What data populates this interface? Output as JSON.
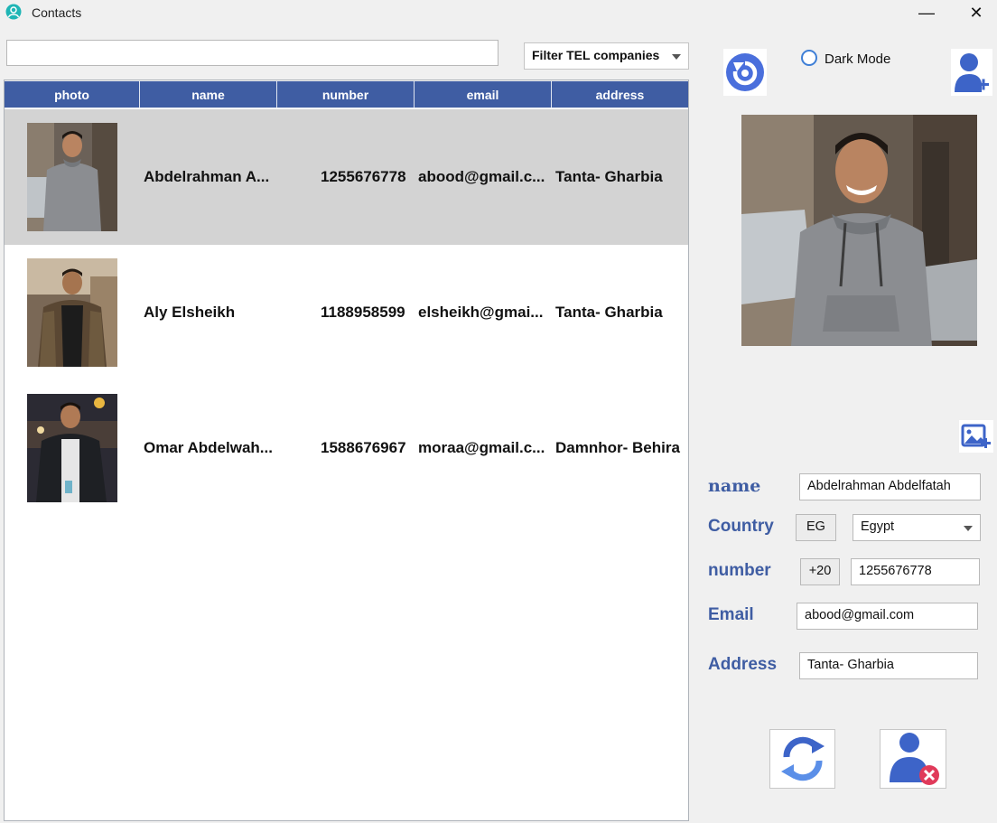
{
  "window": {
    "title": "Contacts",
    "minimize_glyph": "—",
    "close_glyph": "✕"
  },
  "toolbar": {
    "search_value": "",
    "filter_label": "Filter TEL companies",
    "dark_mode_label": "Dark Mode",
    "dark_mode_checked": false
  },
  "table": {
    "columns": [
      "photo",
      "name",
      "number",
      "email",
      "address"
    ],
    "rows": [
      {
        "name": "Abdelrahman A...",
        "number": "1255676778",
        "email": "abood@gmail.c...",
        "address": "Tanta- Gharbia",
        "selected": true,
        "photo_style": "grey-hoodie"
      },
      {
        "name": "Aly Elsheikh",
        "number": "1188958599",
        "email": "elsheikh@gmai...",
        "address": "Tanta- Gharbia",
        "selected": false,
        "photo_style": "plaid-jacket"
      },
      {
        "name": "Omar Abdelwah...",
        "number": "1588676967",
        "email": "moraa@gmail.c...",
        "address": "Damnhor- Behira",
        "selected": false,
        "photo_style": "night-street"
      }
    ]
  },
  "form": {
    "name_label": "name",
    "name_value": "Abdelrahman Abdelfatah",
    "country_label": "Country",
    "country_code": "EG",
    "country_value": "Egypt",
    "number_label": "number",
    "dial_code": "+20",
    "number_value": "1255676778",
    "email_label": "Email",
    "email_value": "abood@gmail.com",
    "address_label": "Address",
    "address_value": "Tanta- Gharbia"
  },
  "icons": {
    "refresh": "refresh-icon",
    "add_user": "add-user-icon",
    "add_image": "add-image-icon",
    "update": "update-icon",
    "delete_user": "delete-user-icon"
  },
  "colors": {
    "header_blue": "#3f5da3",
    "selected_row": "#d3d3d3",
    "accent_blue": "#3f7fd6",
    "delete_red": "#e03a5a"
  }
}
